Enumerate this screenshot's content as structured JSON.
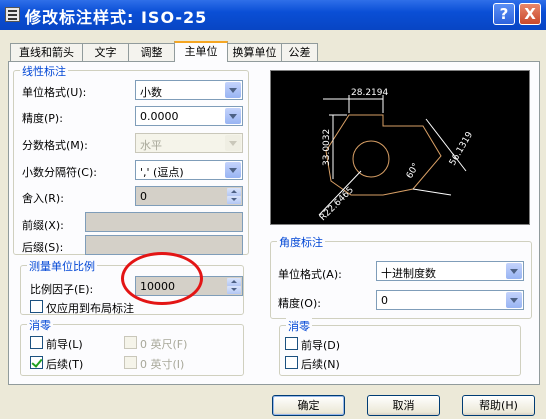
{
  "window": {
    "title": "修改标注样式: ISO-25",
    "help_glyph": "?",
    "close_glyph": "X"
  },
  "tabs": [
    {
      "label": "直线和箭头"
    },
    {
      "label": "文字"
    },
    {
      "label": "调整"
    },
    {
      "label": "主单位",
      "active": true
    },
    {
      "label": "换算单位"
    },
    {
      "label": "公差"
    }
  ],
  "linear": {
    "title": "线性标注",
    "unit_format_label": "单位格式(U):",
    "unit_format_value": "小数",
    "precision_label": "精度(P):",
    "precision_value": "0.0000",
    "fraction_format_label": "分数格式(M):",
    "fraction_format_value": "水平",
    "decimal_sep_label": "小数分隔符(C):",
    "decimal_sep_value": "','  (逗点)",
    "roundoff_label": "舍入(R):",
    "roundoff_value": "0",
    "prefix_label": "前缀(X):",
    "prefix_value": "",
    "suffix_label": "后缀(S):",
    "suffix_value": ""
  },
  "measure_scale": {
    "title": "测量单位比例",
    "scale_factor_label": "比例因子(E):",
    "scale_factor_value": "10000",
    "layout_only_label": "仅应用到布局标注",
    "layout_only_checked": false
  },
  "zero_linear": {
    "title": "消零",
    "leading_label": "前导(L)",
    "leading_checked": false,
    "trailing_label": "后续(T)",
    "trailing_checked": true,
    "feet_label": "0 英尺(F)",
    "inches_label": "0 英寸(I)"
  },
  "preview": {
    "dims": [
      "28.2194",
      "33.0032",
      "56.1319",
      "60°",
      "R22.6465"
    ],
    "line_color": "#ffffff",
    "shape_color": "#d9a066"
  },
  "angular": {
    "title": "角度标注",
    "unit_format_label": "单位格式(A):",
    "unit_format_value": "十进制度数",
    "precision_label": "精度(O):",
    "precision_value": "0"
  },
  "zero_angular": {
    "title": "消零",
    "leading_label": "前导(D)",
    "leading_checked": false,
    "trailing_label": "后续(N)",
    "trailing_checked": false
  },
  "buttons": {
    "ok": "确定",
    "cancel": "取消",
    "help": "帮助(H)"
  },
  "colors": {
    "accent": "#0046d5",
    "annotation": "#e31515"
  }
}
